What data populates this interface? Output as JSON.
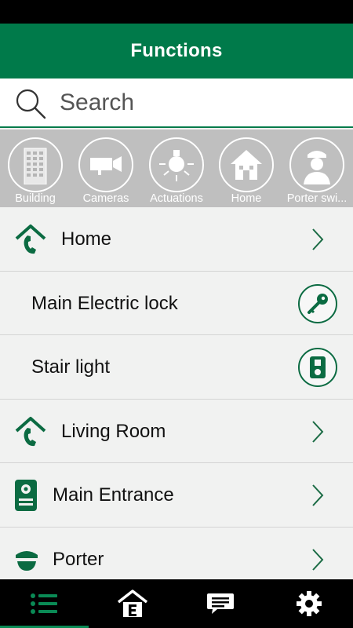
{
  "header": {
    "title": "Functions"
  },
  "search": {
    "placeholder": "Search"
  },
  "categories": [
    {
      "label": "Building",
      "icon": "building-icon"
    },
    {
      "label": "Cameras",
      "icon": "camera-icon"
    },
    {
      "label": "Actuations",
      "icon": "bulb-icon"
    },
    {
      "label": "Home",
      "icon": "home-icon"
    },
    {
      "label": "Porter swi...",
      "icon": "porter-icon"
    }
  ],
  "list": {
    "items": [
      {
        "label": "Home",
        "icon": "home-phone-icon",
        "action": "chevron-right-icon"
      },
      {
        "label": "Main Electric lock",
        "icon": "",
        "action": "key-icon"
      },
      {
        "label": "Stair light",
        "icon": "",
        "action": "light-switch-icon"
      },
      {
        "label": "Living Room",
        "icon": "home-phone-icon",
        "action": "chevron-right-icon"
      },
      {
        "label": "Main Entrance",
        "icon": "door-station-icon",
        "action": "chevron-right-icon"
      },
      {
        "label": "Porter",
        "icon": "porter-hat-icon",
        "action": "chevron-right-icon"
      }
    ]
  },
  "bottom_nav": {
    "tabs": [
      {
        "icon": "list-icon",
        "active": true
      },
      {
        "icon": "house-e-icon",
        "active": false
      },
      {
        "icon": "chat-icon",
        "active": false
      },
      {
        "icon": "gear-icon",
        "active": false
      }
    ]
  },
  "colors": {
    "brand": "#007a4a",
    "status_bar": "#000000",
    "category_bg": "#bfbfbf",
    "list_bg": "#f1f2f1"
  }
}
